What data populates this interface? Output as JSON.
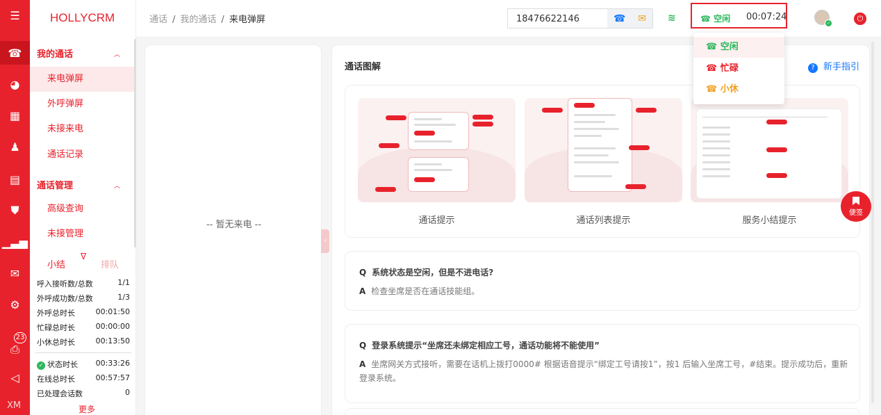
{
  "app": {
    "brand": "HOLLYCRM"
  },
  "rail": {
    "badge_count": "23",
    "footer": "XM"
  },
  "sidebar": {
    "groups": [
      {
        "title": "我的通话",
        "items": [
          "来电弹屏",
          "外呼弹屏",
          "未接来电",
          "通话记录"
        ]
      },
      {
        "title": "通话管理",
        "items": [
          "高级查询",
          "未接管理"
        ]
      }
    ]
  },
  "summary": {
    "tab_active": "小结",
    "tab_inactive": "排队",
    "rows": [
      {
        "label": "呼入接听数/总数",
        "value": "1/1"
      },
      {
        "label": "外呼成功数/总数",
        "value": "1/3"
      },
      {
        "label": "外呼总时长",
        "value": "00:01:50"
      },
      {
        "label": "忙碌总时长",
        "value": "00:00:00"
      },
      {
        "label": "小休总时长",
        "value": "00:13:50"
      }
    ],
    "rows2": [
      {
        "label": "状态时长",
        "value": "00:33:26"
      },
      {
        "label": "在线总时长",
        "value": "00:57:57"
      },
      {
        "label": "已处理会话数",
        "value": "0"
      }
    ],
    "more": "更多"
  },
  "header": {
    "breadcrumb": [
      "通话",
      "我的通话",
      "来电弹屏"
    ],
    "phone_number": "18476622146",
    "status_label": "空闲",
    "status_timer": "00:07:24"
  },
  "status_menu": [
    {
      "label": "空闲",
      "color": "#2db85c"
    },
    {
      "label": "忙碌",
      "color": "#e8222c"
    },
    {
      "label": "小休",
      "color": "#f0a020"
    }
  ],
  "call_panel": {
    "empty": "-- 暂无来电 --"
  },
  "guide": {
    "title": "通话图解",
    "help_link": "新手指引",
    "cards": [
      "通话提示",
      "通话列表提示",
      "服务小结提示"
    ],
    "faq": [
      {
        "q": "系统状态是空闲，但是不进电话?",
        "a": "检查坐席是否在通话技能组。"
      },
      {
        "q": "登录系统提示“坐席还未绑定相应工号，通话功能将不能使用”",
        "a": "坐席网关方式接听，需要在话机上拨打0000# 根据语音提示“绑定工号请按1”，按1 后输入坐席工号，#结束。提示成功后，重新登录系统。"
      }
    ]
  },
  "memo": "便签",
  "colors": {
    "brand": "#e8222c",
    "idle": "#2db85c",
    "busy": "#e8222c",
    "break": "#f0a020",
    "link": "#1677ff"
  }
}
